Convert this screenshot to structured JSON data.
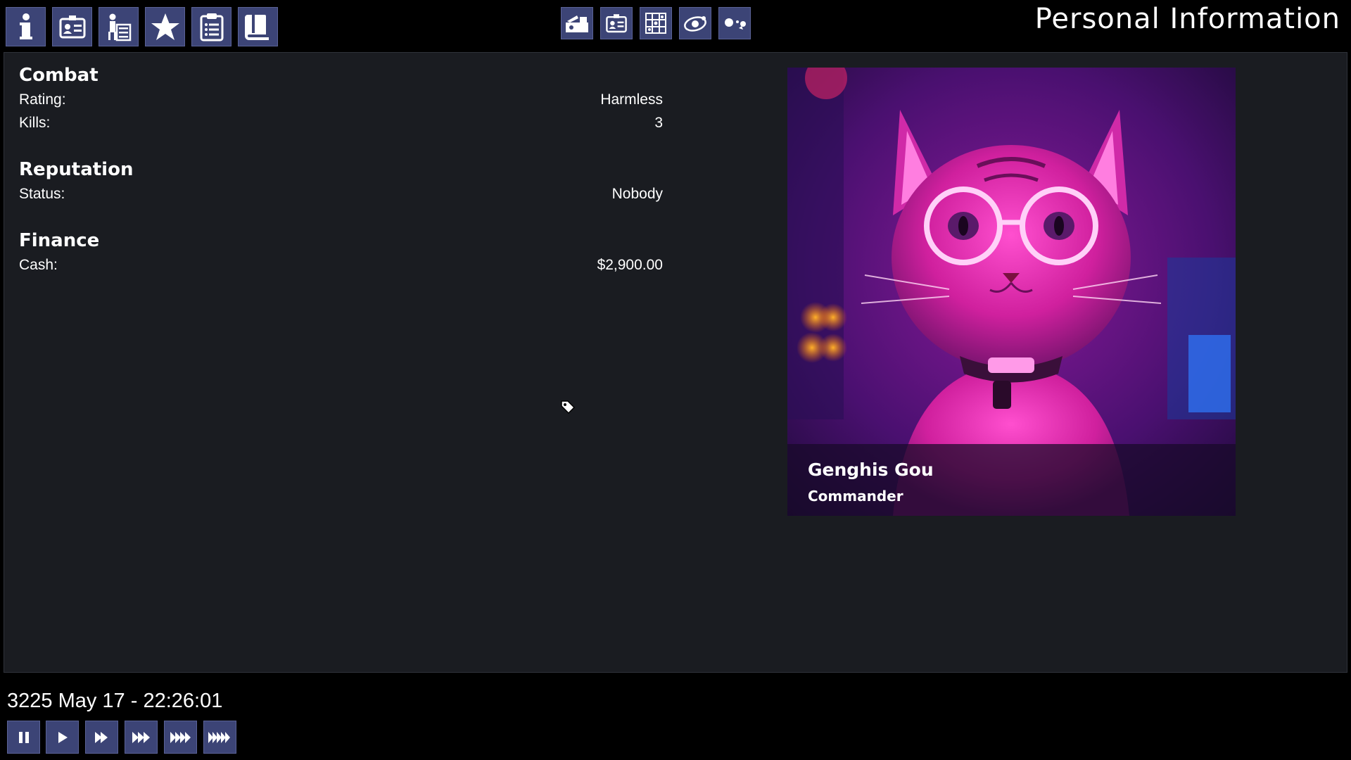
{
  "header": {
    "title": "Personal Information",
    "left_tabs": [
      {
        "icon": "info-icon"
      },
      {
        "icon": "id-card-icon"
      },
      {
        "icon": "crew-icon"
      },
      {
        "icon": "star-icon"
      },
      {
        "icon": "clipboard-icon"
      },
      {
        "icon": "book-icon"
      }
    ],
    "center_views": [
      {
        "icon": "ship-launch-icon"
      },
      {
        "icon": "info-card-icon"
      },
      {
        "icon": "sector-map-icon"
      },
      {
        "icon": "system-orbit-icon"
      },
      {
        "icon": "planets-icon"
      }
    ]
  },
  "stats": {
    "combat": {
      "title": "Combat",
      "rating_label": "Rating:",
      "rating_value": "Harmless",
      "kills_label": "Kills:",
      "kills_value": "3"
    },
    "reputation": {
      "title": "Reputation",
      "status_label": "Status:",
      "status_value": "Nobody"
    },
    "finance": {
      "title": "Finance",
      "cash_label": "Cash:",
      "cash_value": "$2,900.00"
    }
  },
  "portrait": {
    "name": "Genghis Gou",
    "rank": "Commander"
  },
  "footer": {
    "clock": "3225 May 17 - 22:26:01",
    "time_controls": [
      {
        "icon": "pause-icon"
      },
      {
        "icon": "play-icon"
      },
      {
        "icon": "fast-forward-icon"
      },
      {
        "icon": "faster-forward-icon"
      },
      {
        "icon": "very-fast-forward-icon"
      },
      {
        "icon": "fastest-forward-icon"
      }
    ]
  },
  "colors": {
    "button": "#3c4476",
    "panel": "#1a1c21",
    "background": "#000000"
  }
}
